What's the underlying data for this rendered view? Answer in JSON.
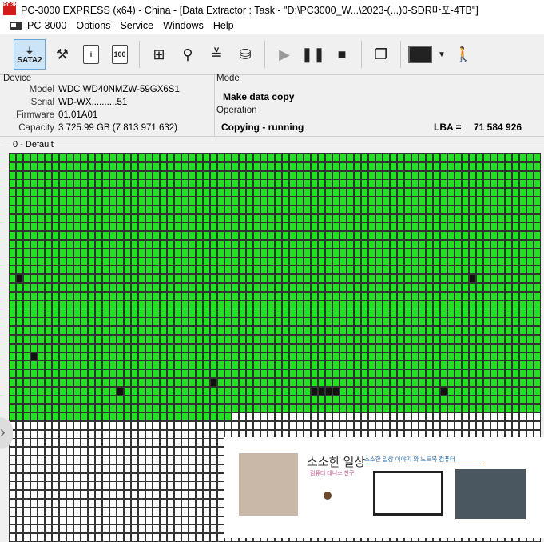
{
  "window": {
    "icon_text": "PC3K",
    "title": "PC-3000 EXPRESS (x64) - China - [Data Extractor : Task - \"D:\\PC3000_W...\\2023-(...)0-SDR마포-4TB\"]"
  },
  "menu": [
    {
      "label": "PC-3000"
    },
    {
      "label": "Options"
    },
    {
      "label": "Service"
    },
    {
      "label": "Windows"
    },
    {
      "label": "Help"
    }
  ],
  "toolbar": {
    "sata_label": "SATA2",
    "page_label": "100"
  },
  "device": {
    "group_title": "Device",
    "rows": [
      {
        "label": "Model",
        "value": "WDC WD40NMZW-59GX6S1"
      },
      {
        "label": "Serial",
        "value": "WD-WX..........51"
      },
      {
        "label": "Firmware",
        "value": "01.01A01"
      },
      {
        "label": "Capacity",
        "value": "3 725.99 GB (7 813 971 632)"
      }
    ]
  },
  "mode": {
    "group_title": "Mode",
    "value": "Make data copy"
  },
  "operation": {
    "group_title": "Operation",
    "status": "Copying - running",
    "lba_label": "LBA =",
    "lba_value": "71 584 926"
  },
  "map": {
    "title": "0 - Default",
    "cols": 74,
    "full_rows": 30,
    "partial_rows": 5,
    "partial_cols": 31,
    "black_cells": [
      [
        14,
        1
      ],
      [
        14,
        64
      ],
      [
        23,
        3
      ],
      [
        26,
        28
      ],
      [
        27,
        15
      ],
      [
        27,
        42
      ],
      [
        27,
        43
      ],
      [
        27,
        44
      ],
      [
        27,
        45
      ],
      [
        27,
        60
      ]
    ]
  },
  "ad": {
    "brand": "소소한 일상",
    "subtitle": "컴퓨터 데니스 친구",
    "tagline": "소소한 일상 이야기 와 노트북 컴퓨터"
  },
  "colors": {
    "good": "#22e022",
    "bad": "#111111",
    "unread": "#ffffff"
  }
}
